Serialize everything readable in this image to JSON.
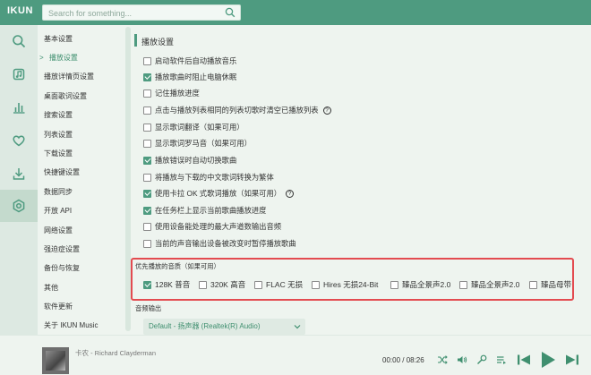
{
  "app": {
    "title": "IKUN"
  },
  "search": {
    "placeholder": "Search for something..."
  },
  "rail": [
    "search-icon",
    "music-note-icon",
    "chart-icon",
    "heart-icon",
    "download-icon",
    "gear-icon"
  ],
  "menu": [
    {
      "label": "基本设置"
    },
    {
      "label": "播放设置",
      "marker": ">",
      "active": true
    },
    {
      "label": "播放详情页设置"
    },
    {
      "label": "桌面歌词设置"
    },
    {
      "label": "搜索设置"
    },
    {
      "label": "列表设置"
    },
    {
      "label": "下载设置"
    },
    {
      "label": "快捷键设置"
    },
    {
      "label": "数据同步"
    },
    {
      "label": "开放 API"
    },
    {
      "label": "网络设置"
    },
    {
      "label": "强迫症设置"
    },
    {
      "label": "备份与恢复"
    },
    {
      "label": "其他"
    },
    {
      "label": "软件更新"
    },
    {
      "label": "关于 IKUN Music"
    }
  ],
  "section": {
    "title": "播放设置"
  },
  "options": [
    {
      "label": "启动软件后自动播放音乐",
      "checked": false
    },
    {
      "label": "播放歌曲时阻止电脑休眠",
      "checked": true
    },
    {
      "label": "记住播放进度",
      "checked": false
    },
    {
      "label": "点击与播放列表相同的列表切歌时清空已播放列表",
      "checked": false,
      "help": "?"
    },
    {
      "label": "显示歌词翻译（如果可用）",
      "checked": false
    },
    {
      "label": "显示歌词罗马音（如果可用）",
      "checked": false
    },
    {
      "label": "播放错误时自动切换歌曲",
      "checked": true
    },
    {
      "label": "将播放与下载的中文歌词转换为繁体",
      "checked": false
    },
    {
      "label": "使用卡拉 OK 式歌词播放（如果可用）",
      "checked": true,
      "help": "?"
    },
    {
      "label": "在任务栏上显示当前歌曲播放进度",
      "checked": true
    },
    {
      "label": "使用设备能处理的最大声道数输出音频",
      "checked": false
    },
    {
      "label": "当前的声音输出设备被改变时暂停播放歌曲",
      "checked": false
    }
  ],
  "quality": {
    "label": "优先播放的音质（如果可用）",
    "options": [
      {
        "label": "128K 普音",
        "checked": true
      },
      {
        "label": "320K 高音",
        "checked": false
      },
      {
        "label": "FLAC 无损",
        "checked": false
      },
      {
        "label": "Hires 无损24-Bit",
        "checked": false
      },
      {
        "label": "臻品全景声2.0",
        "checked": false
      },
      {
        "label": "臻品全景声2.0",
        "checked": false
      },
      {
        "label": "臻品母带",
        "checked": false
      }
    ]
  },
  "output": {
    "label": "音频输出",
    "value": "Default - 扬声器 (Realtek(R) Audio)"
  },
  "player": {
    "track": "卡农 - Richard Clayderman",
    "time": "00:00 / 08:26",
    "controls": [
      "shuffle-icon",
      "volume-icon",
      "lyrics-icon",
      "playlist-icon",
      "previous-icon",
      "play-icon",
      "next-icon"
    ]
  },
  "colors": {
    "accent": "#4e9b80",
    "highlight": "#e34b50",
    "background": "#eef4ef"
  }
}
